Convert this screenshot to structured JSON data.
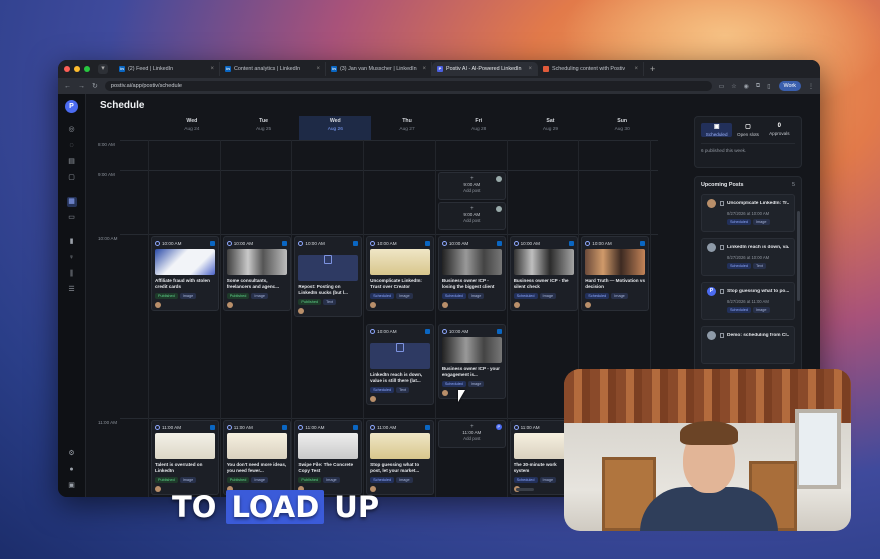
{
  "browser": {
    "tabs": [
      {
        "label": "(2) Feed | LinkedIn",
        "icon": "li",
        "active": false
      },
      {
        "label": "Content analytics | LinkedIn",
        "icon": "li",
        "active": false
      },
      {
        "label": "(3) Jan van Musscher | LinkedIn",
        "icon": "li",
        "active": false
      },
      {
        "label": "Postiv AI - AI-Powered LinkedIn",
        "icon": "p",
        "active": true
      },
      {
        "label": "Scheduling content with Postiv",
        "icon": "o",
        "active": false
      }
    ],
    "url": "postiv.ai/app/postiv/schedule",
    "profile_label": "Work"
  },
  "app": {
    "page_title": "Schedule",
    "logo_letter": "P",
    "sidebar_icons": [
      "dashboard-icon",
      "chat-icon",
      "document-icon",
      "file-icon",
      "calendar-icon",
      "message-icon",
      "chart-icon",
      "lightbulb-icon",
      "library-icon",
      "sliders-icon",
      "settings-icon",
      "user-icon",
      "lock-icon"
    ],
    "days": [
      {
        "name": "Wed",
        "date": "Aug 24"
      },
      {
        "name": "Tue",
        "date": "Aug 25"
      },
      {
        "name": "Wed",
        "date": "Aug 26"
      },
      {
        "name": "Thu",
        "date": "Aug 27"
      },
      {
        "name": "Fri",
        "date": "Aug 28"
      },
      {
        "name": "Sat",
        "date": "Aug 29"
      },
      {
        "name": "Sun",
        "date": "Aug 30"
      }
    ],
    "time_labels": [
      "8:00 AM",
      "9:00 AM",
      "10:00 AM",
      "11:00 AM"
    ],
    "cards_10am": [
      {
        "time": "10:00 AM",
        "title": "Affiliate fraud with stolen credit cards",
        "status": "Published",
        "type": "Image"
      },
      {
        "time": "10:00 AM",
        "title": "Some consultants, freelancers and agenc...",
        "status": "Published",
        "type": "Image"
      },
      {
        "time": "10:00 AM",
        "title": "Repost: Posting on LinkedIn sucks (but l...",
        "status": "Published",
        "type": "Text"
      },
      {
        "time": "10:00 AM",
        "title": "Uncomplicate LinkedIn: Trust over Creator",
        "status": "Scheduled",
        "type": "Image"
      },
      {
        "time": "10:00 AM",
        "title": "Business owner ICP - losing the biggest client",
        "status": "Scheduled",
        "type": "Image"
      },
      {
        "time": "10:00 AM",
        "title": "Business owner ICP - the silent check",
        "status": "Scheduled",
        "type": "Image"
      },
      {
        "time": "10:00 AM",
        "title": "Hard Truth — Motivation vs decision",
        "status": "Scheduled",
        "type": "Image"
      }
    ],
    "cards_10am_row2": [
      {
        "time": "10:00 AM",
        "title": "LinkedIn reach is down, value is still there (lat...",
        "status": "Scheduled",
        "type": "Text"
      },
      {
        "time": "10:00 AM",
        "title": "Business owner ICP - your engagement is...",
        "status": "Scheduled",
        "type": "Image"
      }
    ],
    "cards_11am": [
      {
        "time": "11:00 AM",
        "title": "Talent is overrated on LinkedIn",
        "status": "Published",
        "type": "Image"
      },
      {
        "time": "11:00 AM",
        "title": "You don't need more ideas, you need fewer...",
        "status": "Published",
        "type": "Image"
      },
      {
        "time": "11:00 AM",
        "title": "Swipe File: The Concrete Copy Test",
        "status": "Published",
        "type": "Image"
      },
      {
        "time": "11:00 AM",
        "title": "Stop guessing what to post, let your market...",
        "status": "Scheduled",
        "type": "Image"
      },
      {
        "time": "11:00 AM",
        "title": "The 30-minute work system",
        "status": "Scheduled",
        "type": "Image"
      }
    ],
    "add_slots": [
      {
        "time": "9:00 AM",
        "label": "Add post"
      },
      {
        "time": "9:00 AM",
        "label": "Add post"
      },
      {
        "time": "11:00 AM",
        "label": "Add post"
      }
    ],
    "stats": {
      "tabs": [
        "Scheduled",
        "Open slots",
        "Approvals"
      ],
      "note": "6 published this week."
    },
    "upcoming": {
      "title": "Upcoming Posts",
      "count": "5",
      "items": [
        {
          "title": "Uncomplicate LinkedIn: Tr...",
          "date": "8/27/2026 at 10:00 AM",
          "status": "Scheduled",
          "type": "Image"
        },
        {
          "title": "LinkedIn reach is down, va...",
          "date": "8/27/2026 at 10:00 AM",
          "status": "Scheduled",
          "type": "Text"
        },
        {
          "title": "Stop guessing what to po...",
          "date": "8/27/2026 at 11:00 AM",
          "status": "Scheduled",
          "type": "Image"
        },
        {
          "title": "Demo: scheduling from Cl...",
          "date": "",
          "status": "",
          "type": ""
        }
      ]
    }
  },
  "caption": {
    "words": [
      "TO",
      "LOAD",
      "UP"
    ]
  }
}
